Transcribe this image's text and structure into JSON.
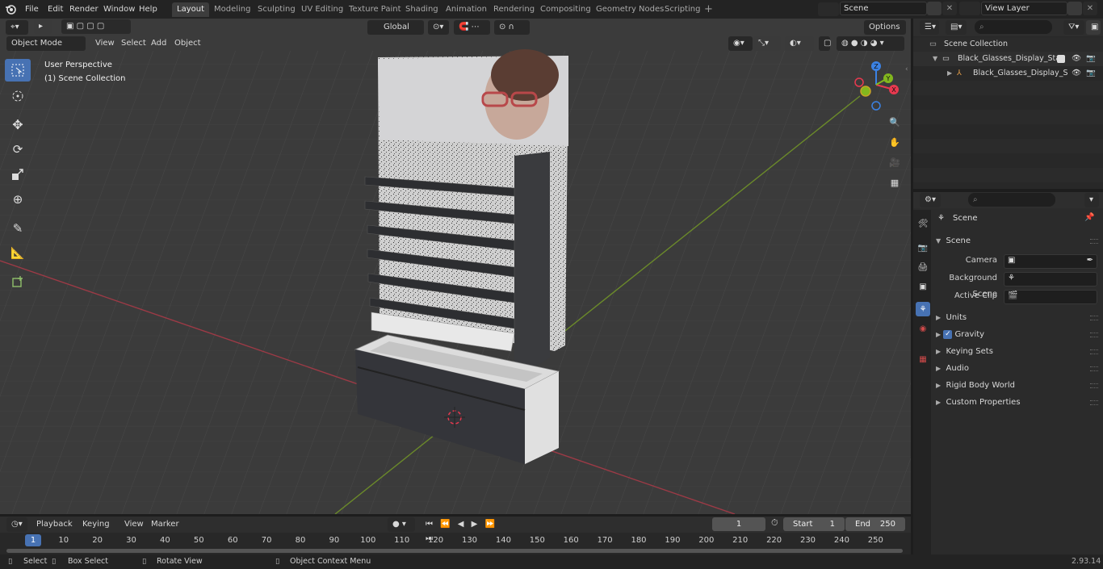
{
  "menu": [
    "File",
    "Edit",
    "Render",
    "Window",
    "Help"
  ],
  "workspaces": [
    {
      "label": "Layout",
      "active": true
    },
    {
      "label": "Modeling"
    },
    {
      "label": "Sculpting"
    },
    {
      "label": "UV Editing"
    },
    {
      "label": "Texture Paint"
    },
    {
      "label": "Shading"
    },
    {
      "label": "Animation"
    },
    {
      "label": "Rendering"
    },
    {
      "label": "Compositing"
    },
    {
      "label": "Geometry Nodes"
    },
    {
      "label": "Scripting"
    }
  ],
  "scene_field": "Scene",
  "view_layer_field": "View Layer",
  "viewport": {
    "mode": "Object Mode",
    "menus": [
      "View",
      "Select",
      "Add",
      "Object"
    ],
    "transform_orientation": "Global",
    "options": "Options",
    "overlay_title": "User Perspective",
    "overlay_subtitle": "(1) Scene Collection",
    "gizmo_axes": {
      "x": "X",
      "y": "Y",
      "z": "Z"
    }
  },
  "outliner": {
    "root": "Scene Collection",
    "collection": "Black_Glasses_Display_Stand",
    "object": "Black_Glasses_Display_S"
  },
  "properties": {
    "header": "Scene",
    "panel": "Scene",
    "fields": [
      {
        "label": "Camera"
      },
      {
        "label": "Background Scene"
      },
      {
        "label": "Active Clip"
      }
    ],
    "sections": [
      "Units",
      "Gravity",
      "Keying Sets",
      "Audio",
      "Rigid Body World",
      "Custom Properties"
    ]
  },
  "timeline": {
    "menus": [
      "Playback",
      "Keying",
      "View",
      "Marker"
    ],
    "current_frame": "1",
    "start_label": "Start",
    "start": "1",
    "end_label": "End",
    "end": "250",
    "ruler": [
      "1",
      "10",
      "20",
      "30",
      "40",
      "50",
      "60",
      "70",
      "80",
      "90",
      "100",
      "110",
      "120",
      "130",
      "140",
      "150",
      "160",
      "170",
      "180",
      "190",
      "200",
      "210",
      "220",
      "230",
      "240",
      "250"
    ]
  },
  "status": {
    "select": "Select",
    "box_select": "Box Select",
    "rotate_view": "Rotate View",
    "context_menu": "Object Context Menu",
    "version": "2.93.14"
  },
  "colors": {
    "accent": "#4772b3",
    "axis_x": "#e8394f",
    "axis_y": "#82b71e",
    "axis_z": "#3b82e4",
    "viewport_bg": "#3b3b3b"
  }
}
